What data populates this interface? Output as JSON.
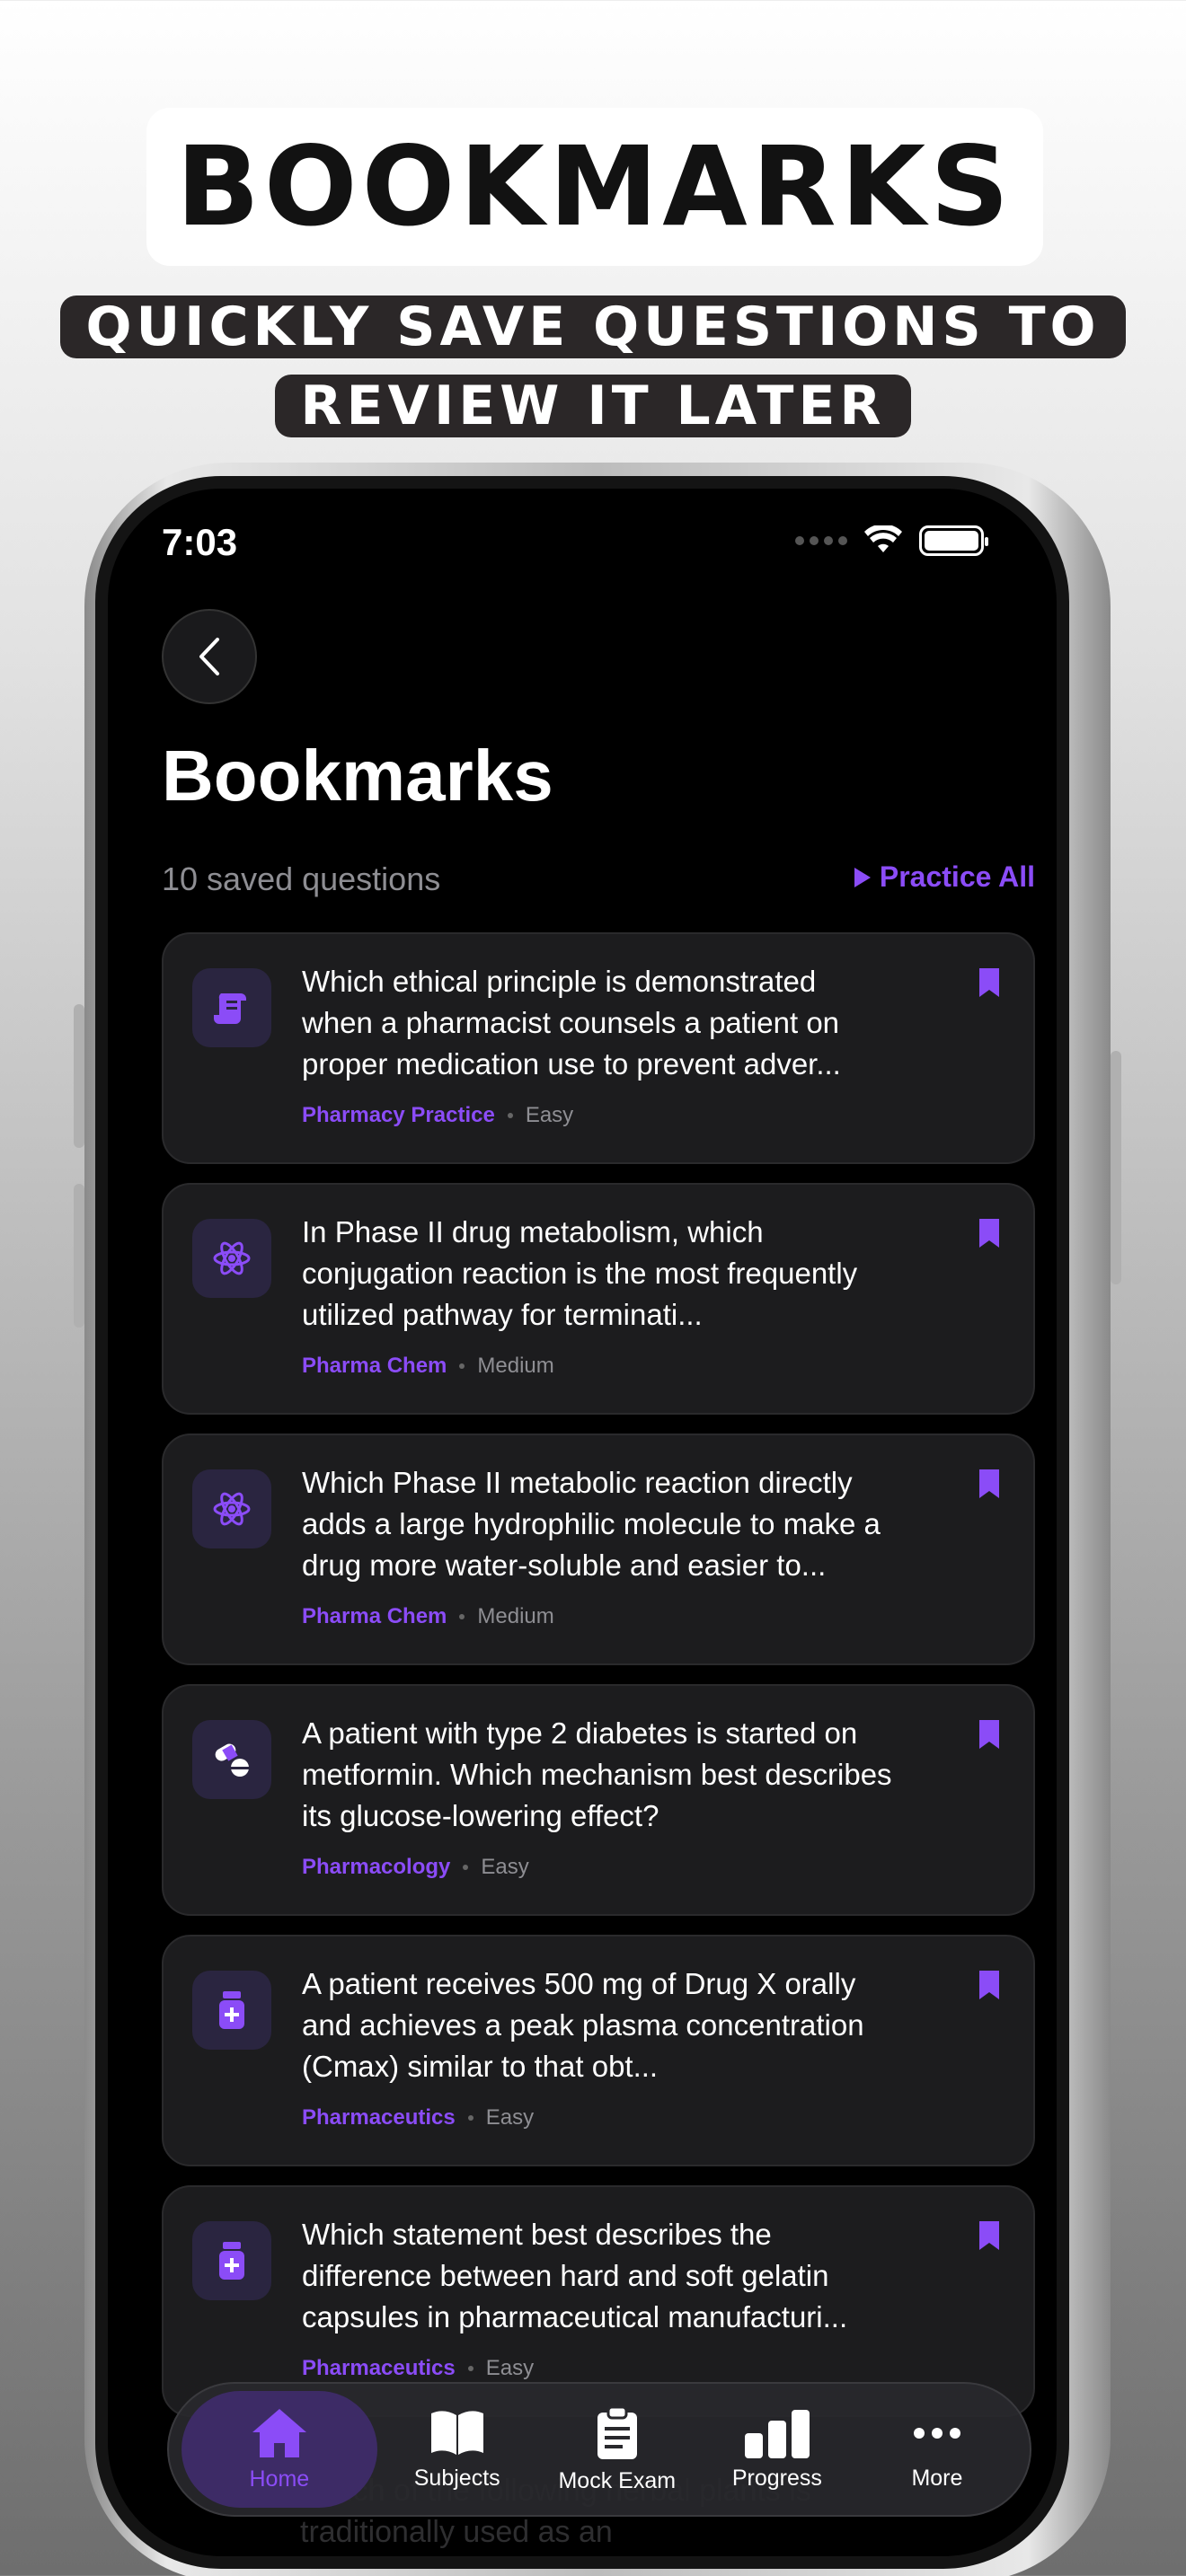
{
  "promo": {
    "title": "BOOKMARKS",
    "subtitle_line1": "QUICKLY SAVE QUESTIONS TO",
    "subtitle_line2": "REVIEW IT LATER"
  },
  "status_bar": {
    "time": "7:03"
  },
  "header": {
    "title": "Bookmarks",
    "saved_count": "10 saved questions",
    "practice_all": "Practice All"
  },
  "colors": {
    "accent": "#8b4cf7",
    "card": "#1c1c1e",
    "background": "#000000"
  },
  "bookmarks": [
    {
      "icon": "scroll-icon",
      "question": "Which ethical principle is demonstrated when a pharmacist counsels a patient on proper medication use to prevent adver...",
      "subject": "Pharmacy Practice",
      "difficulty": "Easy"
    },
    {
      "icon": "atom-icon",
      "question": "In Phase II drug metabolism, which conjugation reaction is the most frequently utilized pathway for terminati...",
      "subject": "Pharma Chem",
      "difficulty": "Medium"
    },
    {
      "icon": "atom-icon",
      "question": "Which Phase II metabolic reaction directly adds a large hydrophilic molecule to make a drug more water-soluble and easier to...",
      "subject": "Pharma Chem",
      "difficulty": "Medium"
    },
    {
      "icon": "pills-icon",
      "question": "A patient with type 2 diabetes is started on metformin. Which mechanism best describes its glucose-lowering effect?",
      "subject": "Pharmacology",
      "difficulty": "Easy"
    },
    {
      "icon": "medicine-bottle-icon",
      "question": "A patient receives 500 mg of Drug X orally and achieves a peak plasma concentration (Cmax) similar to that obt...",
      "subject": "Pharmaceutics",
      "difficulty": "Easy"
    },
    {
      "icon": "medicine-bottle-icon",
      "question": "Which statement best describes the difference between hard and soft gelatin capsules in pharmaceutical manufacturi...",
      "subject": "Pharmaceutics",
      "difficulty": "Easy"
    }
  ],
  "peek_text": "Which of the following herbal plants is traditionally used as an",
  "tabs": [
    {
      "label": "Home",
      "icon": "home-icon",
      "active": true
    },
    {
      "label": "Subjects",
      "icon": "book-icon",
      "active": false
    },
    {
      "label": "Mock Exam",
      "icon": "clipboard-icon",
      "active": false
    },
    {
      "label": "Progress",
      "icon": "bar-chart-icon",
      "active": false
    },
    {
      "label": "More",
      "icon": "more-icon",
      "active": false
    }
  ]
}
